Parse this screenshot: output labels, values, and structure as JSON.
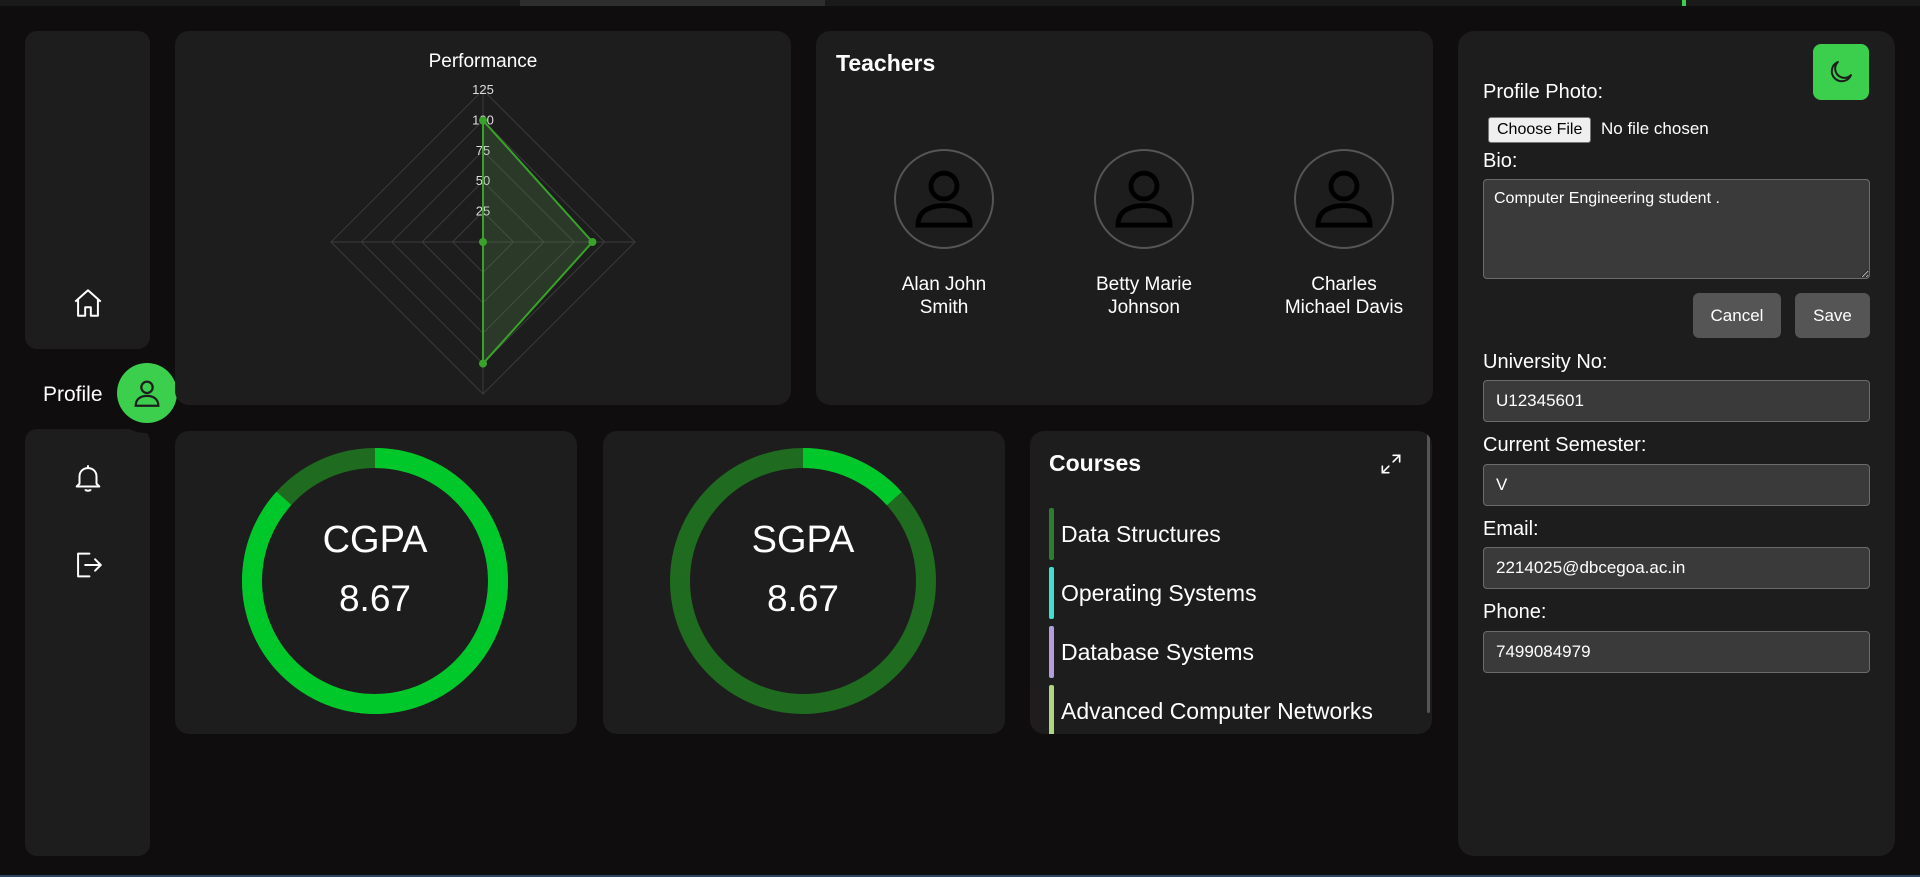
{
  "sidebar": {
    "items": [
      {
        "name": "home",
        "icon": "home-icon"
      },
      {
        "name": "profile",
        "label": "Profile",
        "icon": "user-icon",
        "active": true
      },
      {
        "name": "notifications",
        "icon": "bell-icon"
      },
      {
        "name": "logout",
        "icon": "logout-icon"
      }
    ]
  },
  "performance": {
    "chart_data": {
      "type": "radar",
      "title": "Performance",
      "axis_max": 125,
      "ticks": [
        "25",
        "50",
        "75",
        "100",
        "125"
      ],
      "values": [
        100,
        90,
        100,
        0
      ],
      "series_color": "#3aa12a"
    }
  },
  "teachers": {
    "title": "Teachers",
    "list": [
      {
        "name": "Alan John Smith",
        "line1": "Alan John",
        "line2": "Smith"
      },
      {
        "name": "Betty Marie Johnson",
        "line1": "Betty Marie",
        "line2": "Johnson"
      },
      {
        "name": "Charles Michael Davis",
        "line1": "Charles",
        "line2": "Michael Davis"
      }
    ]
  },
  "gauges": {
    "cgpa": {
      "label": "CGPA",
      "value": "8.67",
      "fraction": 0.867
    },
    "sgpa": {
      "label": "SGPA",
      "value": "8.67",
      "fraction": 0.133
    }
  },
  "courses": {
    "title": "Courses",
    "items": [
      {
        "name": "Data Structures",
        "color": "#2e7d32"
      },
      {
        "name": "Operating Systems",
        "color": "#40e0d0"
      },
      {
        "name": "Database Systems",
        "color": "#b39ddb"
      },
      {
        "name": "Advanced Computer Networks",
        "color": "#aed581"
      }
    ]
  },
  "form": {
    "profile_photo_label": "Profile Photo:",
    "choose_file": "Choose File",
    "file_status": "No file chosen",
    "bio_label": "Bio:",
    "bio_value": "Computer Engineering student .",
    "cancel": "Cancel",
    "save": "Save",
    "university_label": "University No:",
    "university_value": "U12345601",
    "semester_label": "Current Semester:",
    "semester_value": "V",
    "email_label": "Email:",
    "email_value": "2214025@dbcegoa.ac.in",
    "phone_label": "Phone:",
    "phone_value": "7499084979"
  },
  "colors": {
    "accent": "#3ccf4e",
    "gauge_bright": "#00c82a",
    "gauge_dark": "#1f6b1f",
    "panel": "#1d1d1d"
  }
}
